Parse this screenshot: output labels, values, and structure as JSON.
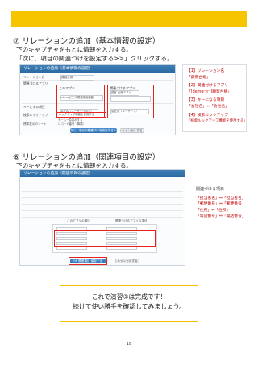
{
  "section1": {
    "title": "⑦ リレーションの追加（基本情報の設定）",
    "desc1": "下のキャプチャをもとに情報を入力する。",
    "desc2": "「次に、項目の関連づけを設定する>>」クリックする。"
  },
  "panel1": {
    "header": "リレーションの追加（基本情報の設定）",
    "rows": [
      "リレーション名",
      "関連づけるアプリ",
      "キーにする項目",
      "検索ルックアップ"
    ],
    "name_value": "顧客台帳",
    "app_value_left": "[demo]□□1関連検索機能",
    "app_value_right": "顧客 台帳アプリ",
    "key_left": "会社名（ユーザーリボン）",
    "key_right": "会社名（ユーザー...）",
    "lookup_left": "ルックアップ機能を使用する",
    "lookup_option": "チーム一覧表示する",
    "sort_label": "標準表示のソート",
    "sort_value": "レコード番号（降順）",
    "ok_button": "次に、項目の関連づけを設定する>>",
    "cancel_button": "キャンセルする"
  },
  "notes1": [
    {
      "heading": "【1】リレーション名",
      "value": "「顧客台帳」"
    },
    {
      "heading": "【2】関連付けるアプリ",
      "value": "「[demo□□]顧客台帳」"
    },
    {
      "heading": "【3】キーになる項目",
      "value": "「会社名」⇔「会社名」"
    },
    {
      "heading": "【4】検索ルックアップ",
      "value": "「検索ルックアップ機能を使用する」"
    }
  ],
  "section2": {
    "title": "⑧ リレーションの追加（関連項目の設定）",
    "desc1": "下のキャプチャをもとに情報を入力する。"
  },
  "panel2": {
    "header": "リレーションの追加（関連項目の設定）",
    "ok_button": "OK 関連項目 保存する",
    "cancel_button": "キャンセルする",
    "column_left": "このアプリの項目",
    "column_right": "関連づけるアプリの項目",
    "rows": 6
  },
  "notes2": {
    "heading": "関連づける項目",
    "lines": [
      "「担当者名」⇔「担当者名」",
      "「郵便番号」⇔「郵便番号」",
      "「住所」⇔「住所」",
      "「電話番号」⇔「電話番号」"
    ]
  },
  "callout": {
    "line1": "これで演習③は完成です！",
    "line2": "続けて使い勝手を確認してみましょう。"
  },
  "page_number": "18",
  "colors": {
    "accent_bar": "#f7c400",
    "highlight": "#e8211f",
    "note_text": "#c00000",
    "header_blue": "#2b6aa2"
  }
}
